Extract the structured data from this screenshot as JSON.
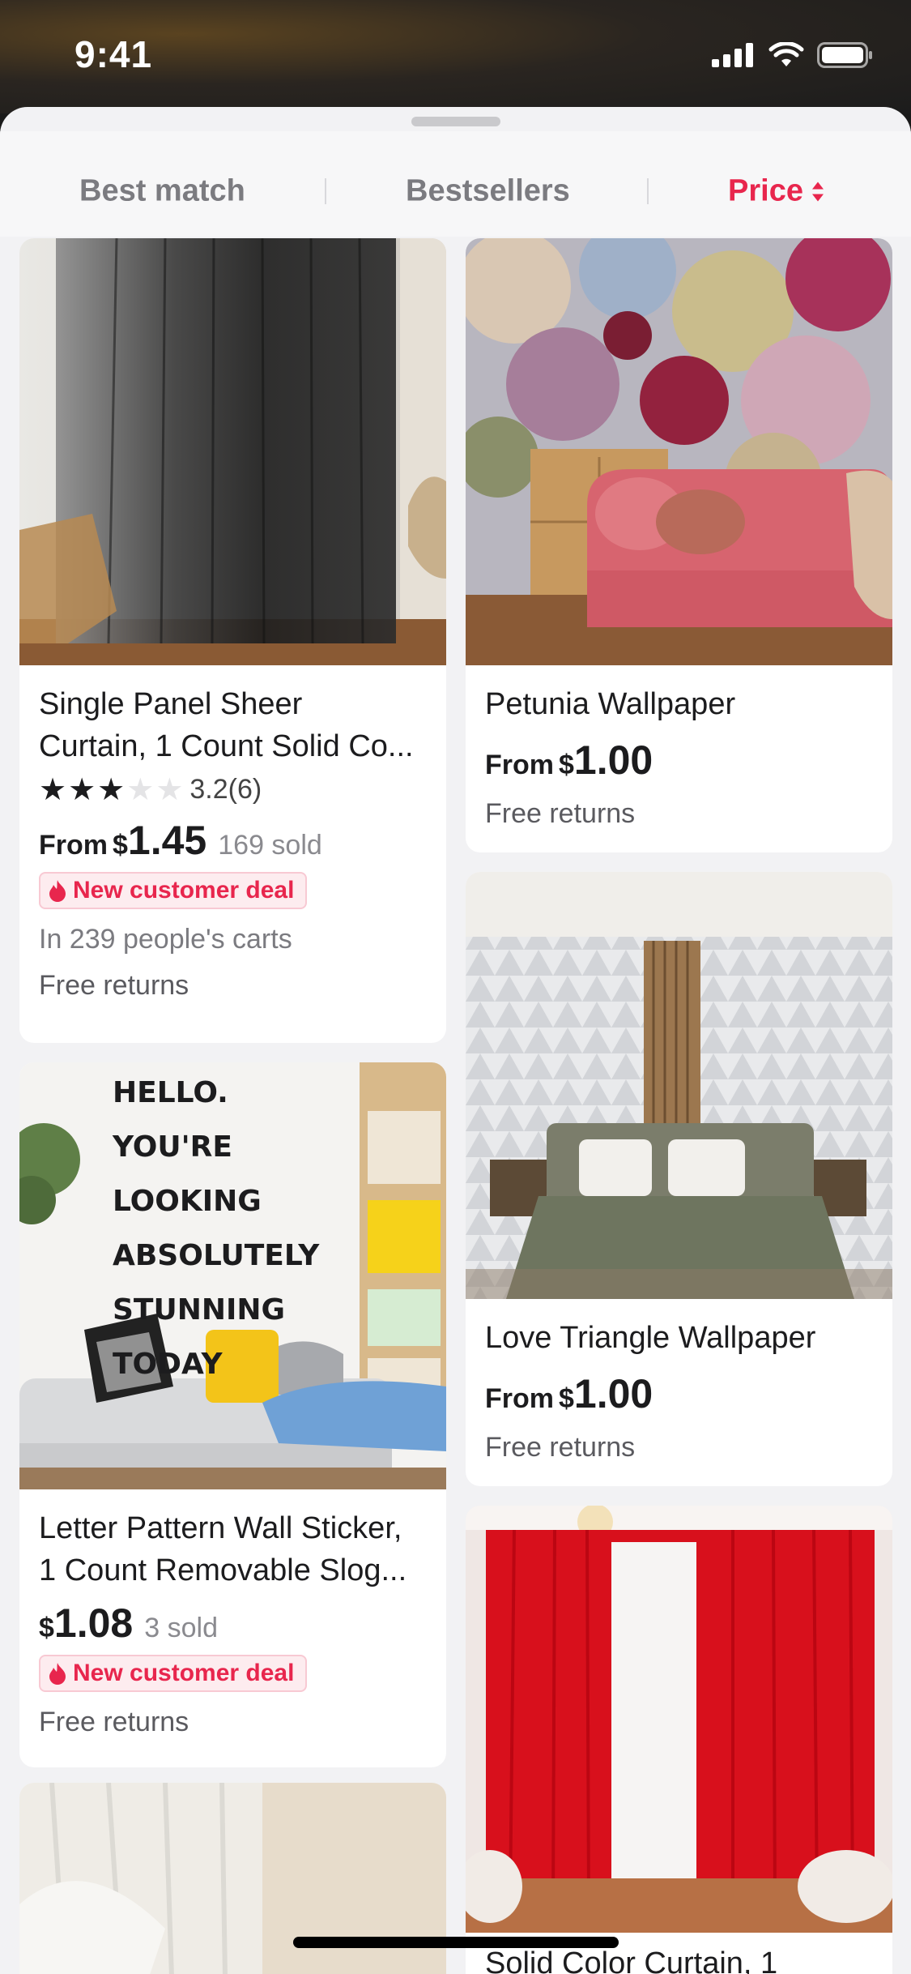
{
  "status_bar": {
    "time": "9:41"
  },
  "sort_tabs": [
    {
      "label": "Best match"
    },
    {
      "label": "Bestsellers"
    },
    {
      "label": "Price"
    }
  ],
  "accent_color": "#e8264d",
  "products": [
    {
      "title_line1": "Single Panel Sheer",
      "title_line2": "Curtain, 1 Count Solid Co...",
      "rating": "3.2",
      "reviews": "(6)",
      "stars_filled": 3,
      "price_prefix": "From",
      "currency": "$",
      "price": "1.45",
      "sold": "169 sold",
      "badge": "New customer deal",
      "carts": "In 239 people's carts",
      "returns": "Free returns"
    },
    {
      "title_line1": "Petunia Wallpaper",
      "price_prefix": "From",
      "currency": "$",
      "price": "1.00",
      "returns": "Free returns"
    },
    {
      "title_line1": "Letter Pattern Wall Sticker,",
      "title_line2": "1 Count Removable Slog...",
      "currency": "$",
      "price": "1.08",
      "sold": "3 sold",
      "badge": "New customer deal",
      "returns": "Free returns",
      "image_text": [
        "HELLO.",
        "YOU'RE LOOKING",
        "ABSOLUTELY",
        "STUNNING",
        "TODAY"
      ]
    },
    {
      "title_line1": "Love Triangle Wallpaper",
      "price_prefix": "From",
      "currency": "$",
      "price": "1.00",
      "returns": "Free returns"
    },
    {
      "title_line1": "Solid Color Curtain, 1"
    }
  ]
}
